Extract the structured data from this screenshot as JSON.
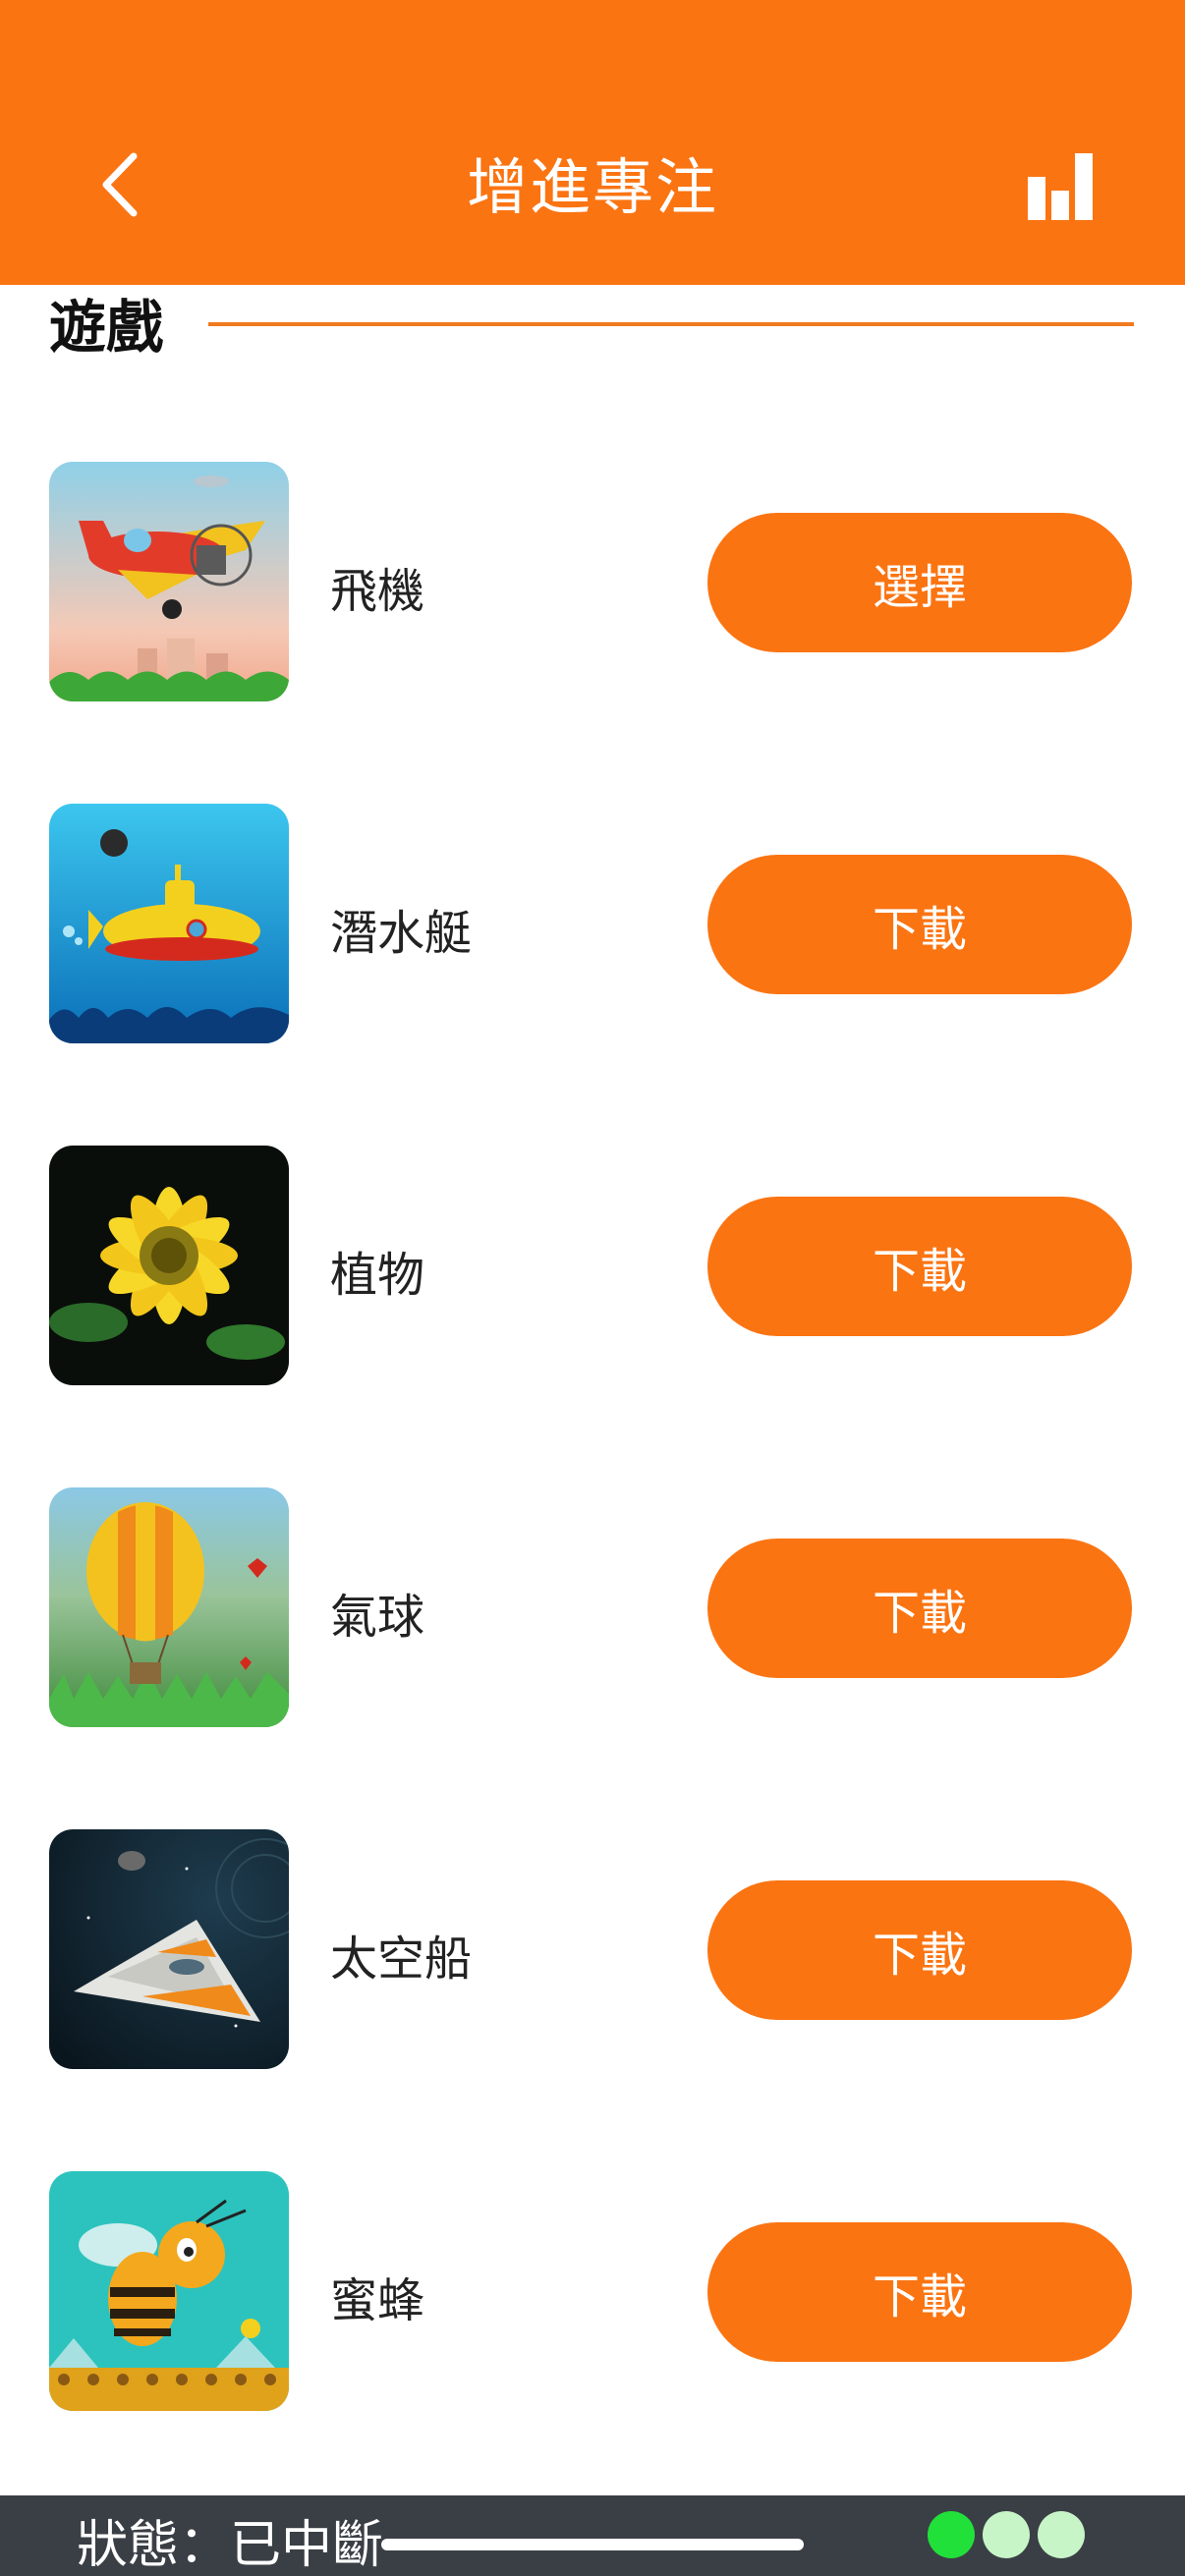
{
  "header": {
    "title": "增進專注",
    "back_icon": "chevron-left-icon",
    "stats_icon": "bar-chart-icon",
    "background": "#FB7412"
  },
  "section": {
    "title": "遊戲",
    "rule_color": "#F07A1E"
  },
  "games": [
    {
      "name": "飛機",
      "action": "選擇",
      "thumbnail": "airplane-thumbnail"
    },
    {
      "name": "潛水艇",
      "action": "下載",
      "thumbnail": "submarine-thumbnail"
    },
    {
      "name": "植物",
      "action": "下載",
      "thumbnail": "sunflower-thumbnail"
    },
    {
      "name": "氣球",
      "action": "下載",
      "thumbnail": "hot-air-balloon-thumbnail"
    },
    {
      "name": "太空船",
      "action": "下載",
      "thumbnail": "spaceship-thumbnail"
    },
    {
      "name": "蜜蜂",
      "action": "下載",
      "thumbnail": "bee-thumbnail"
    }
  ],
  "status_bar": {
    "status": "狀態：已中斷",
    "background": "#3A3F45",
    "indicator_colors": [
      "#22E03A",
      "#C8F5C8",
      "#C8F5C8"
    ]
  },
  "colors": {
    "accent": "#FB7412",
    "button_text": "#FFFFFF"
  }
}
